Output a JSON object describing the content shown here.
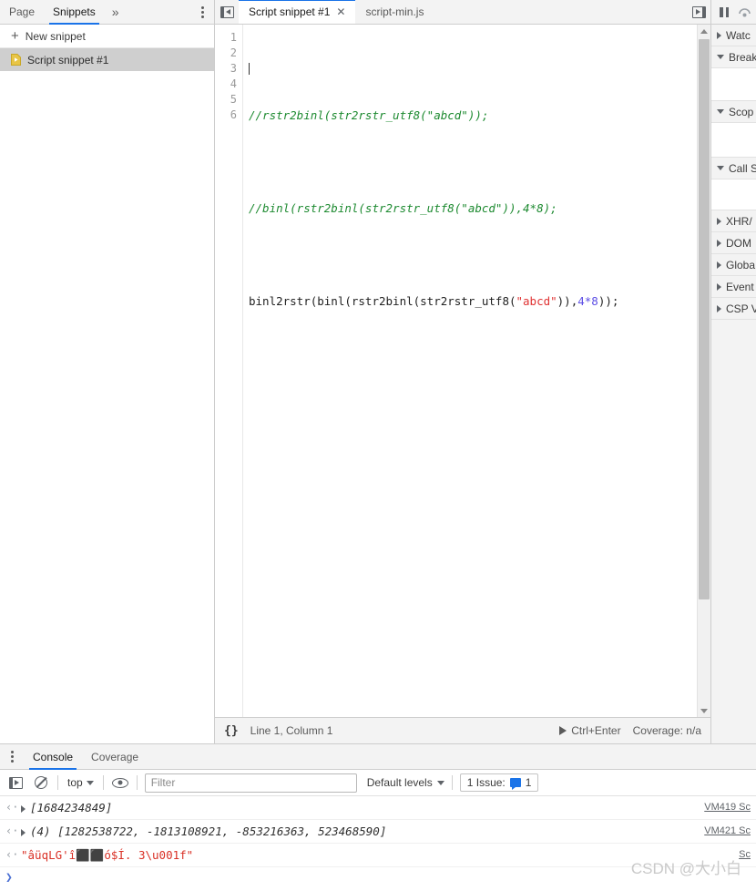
{
  "navigator": {
    "tabs": [
      {
        "label": "Page",
        "active": false
      },
      {
        "label": "Snippets",
        "active": true
      }
    ],
    "more_icon": "»",
    "menu_icon": "more-vertical-icon",
    "new_snippet": {
      "plus": "+",
      "label": "New snippet"
    },
    "items": [
      {
        "label": "Script snippet #1",
        "icon": "snippet-file-icon",
        "selected": true
      }
    ]
  },
  "editor": {
    "toggle_left_icon": "panel-collapse-left-icon",
    "toggle_right_icon": "panel-expand-right-icon",
    "tabs": [
      {
        "label": "Script snippet #1",
        "active": true,
        "close": "✕"
      },
      {
        "label": "script-min.js",
        "active": false
      }
    ],
    "gutter": [
      "1",
      "2",
      "3",
      "4",
      "5",
      "6"
    ],
    "code": {
      "line1": "",
      "line2": "//rstr2binl(str2rstr_utf8(\"abcd\"));",
      "line3": "",
      "line4": "//binl(rstr2binl(str2rstr_utf8(\"abcd\")),4*8);",
      "line6_a": "binl2rstr(binl(rstr2binl(str2rstr_utf8(",
      "line6_str": "\"abcd\"",
      "line6_b": ")),",
      "line6_num": "4*8",
      "line6_c": "));"
    },
    "status": {
      "format_icon": "{}",
      "position": "Line 1, Column 1",
      "run_shortcut": "Ctrl+Enter",
      "coverage": "Coverage: n/a"
    }
  },
  "debugger": {
    "toolbar": {
      "pause_icon": "pause-icon",
      "step_over_icon": "step-over-icon"
    },
    "sections": [
      {
        "label": "Watc",
        "expanded": false
      },
      {
        "label": "Break",
        "expanded": true
      },
      {
        "label": "Scop",
        "expanded": true
      },
      {
        "label": "Call S",
        "expanded": true
      },
      {
        "label": "XHR/",
        "expanded": false
      },
      {
        "label": "DOM",
        "expanded": false
      },
      {
        "label": "Globa",
        "expanded": false
      },
      {
        "label": "Event",
        "expanded": false
      },
      {
        "label": "CSP V",
        "expanded": false
      }
    ]
  },
  "drawer": {
    "menu_icon": "more-vertical-icon",
    "tabs": [
      {
        "label": "Console",
        "active": true
      },
      {
        "label": "Coverage",
        "active": false
      }
    ],
    "toolbar": {
      "sidebar_toggle_icon": "console-sidebar-toggle-icon",
      "clear_icon": "clear-console-icon",
      "context": "top",
      "eye_icon": "live-expression-eye-icon",
      "filter_placeholder": "Filter",
      "filter_value": "",
      "levels": "Default levels",
      "issues_label": "1 Issue:",
      "issues_count": "1"
    },
    "messages": [
      {
        "type": "result-array",
        "arrow": "‹·",
        "expandable": true,
        "count": "",
        "text": "[1684234849]",
        "source": "VM419  Sc"
      },
      {
        "type": "result-array",
        "arrow": "‹·",
        "expandable": true,
        "count": "(4) ",
        "text": "[1282538722, -1813108921, -853216363, 523468590]",
        "source": "VM421  Sc"
      },
      {
        "type": "result-string",
        "arrow": "‹·",
        "expandable": false,
        "count": "",
        "text": "\"âüqLG'î⬛⬛ó$Í. 3\\u001f\"",
        "source": "Sc"
      }
    ],
    "prompt_chevron": "❯"
  },
  "watermark": "CSDN @大小白",
  "colors": {
    "accent": "#1a73e8",
    "comment": "#1d8a30",
    "string": "#e03333",
    "number": "#5c4ee5",
    "selection": "#cfcfcf",
    "toolbar_bg": "#f3f3f3",
    "console_string": "#d93025",
    "console_number": "#5c4ee5"
  }
}
